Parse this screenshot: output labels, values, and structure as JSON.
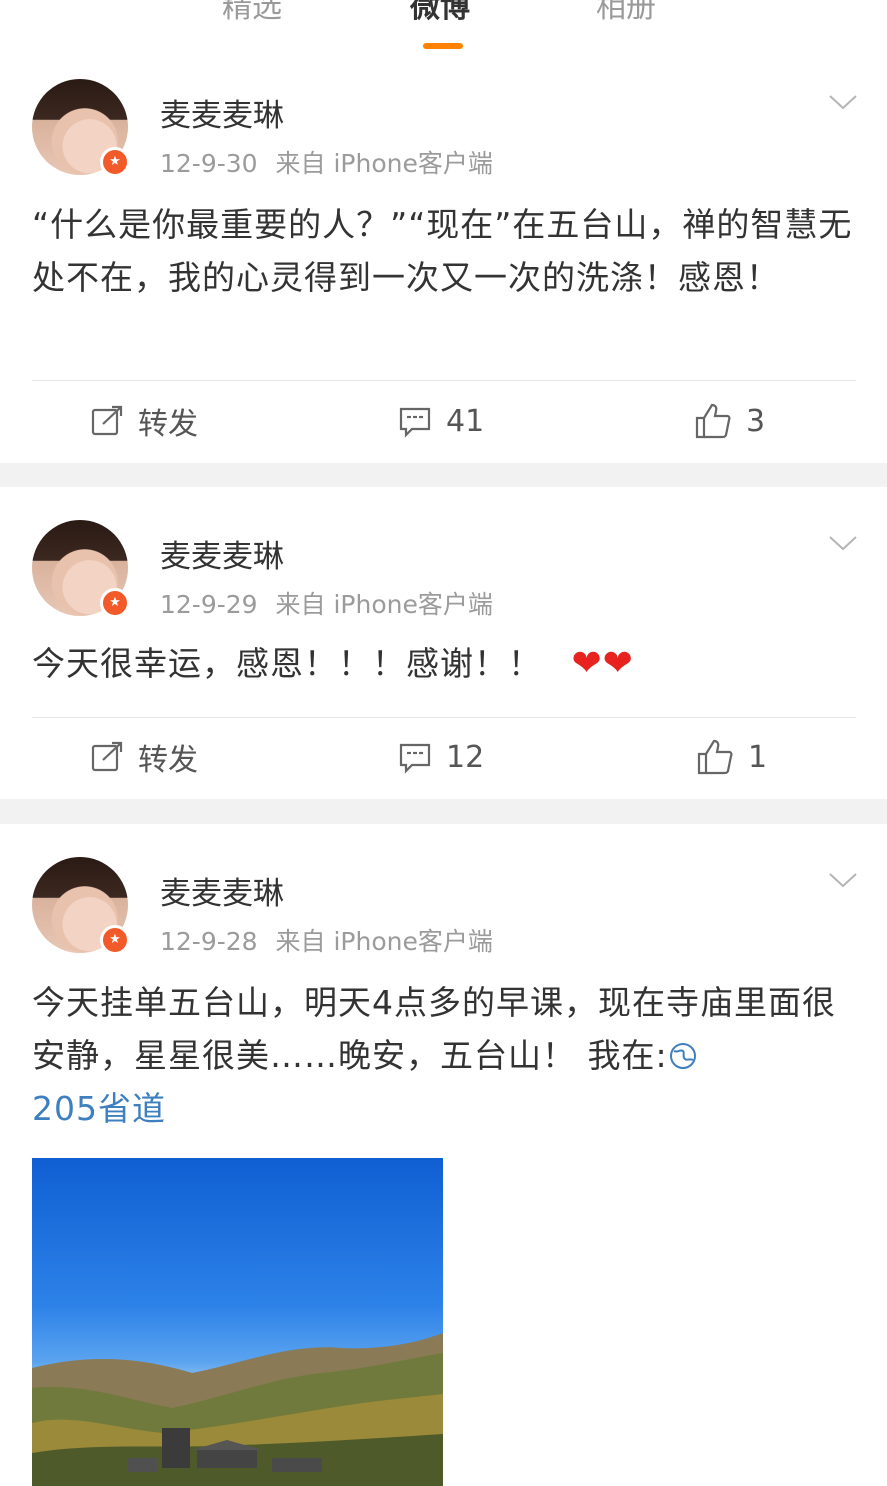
{
  "tabs": [
    {
      "label": "精选"
    },
    {
      "label": "微博"
    },
    {
      "label": "相册"
    }
  ],
  "posts": [
    {
      "author": "麦麦麦琳",
      "date": "12-9-30",
      "source": "来自 iPhone客户端",
      "content": "“什么是你最重要的人？”“现在”在五台山，禅的智慧无处不在，我的心灵得到一次又一次的洗涤！感恩！",
      "repost_label": "转发",
      "comments": "41",
      "likes": "3"
    },
    {
      "author": "麦麦麦琳",
      "date": "12-9-29",
      "source": "来自 iPhone客户端",
      "content": "今天很幸运，感恩！！！感谢！！",
      "emoji": "❤❤",
      "repost_label": "转发",
      "comments": "12",
      "likes": "1"
    },
    {
      "author": "麦麦麦琳",
      "date": "12-9-28",
      "source": "来自 iPhone客户端",
      "content": "今天挂单五台山，明天4点多的早课，现在寺庙里面很安静，星星很美……晚安，五台山！ 我在:",
      "location": "205省道"
    }
  ],
  "colors": {
    "accent": "#ff8200",
    "link": "#3e7fbf",
    "badge": "#f25a29",
    "heart": "#e8231f"
  }
}
